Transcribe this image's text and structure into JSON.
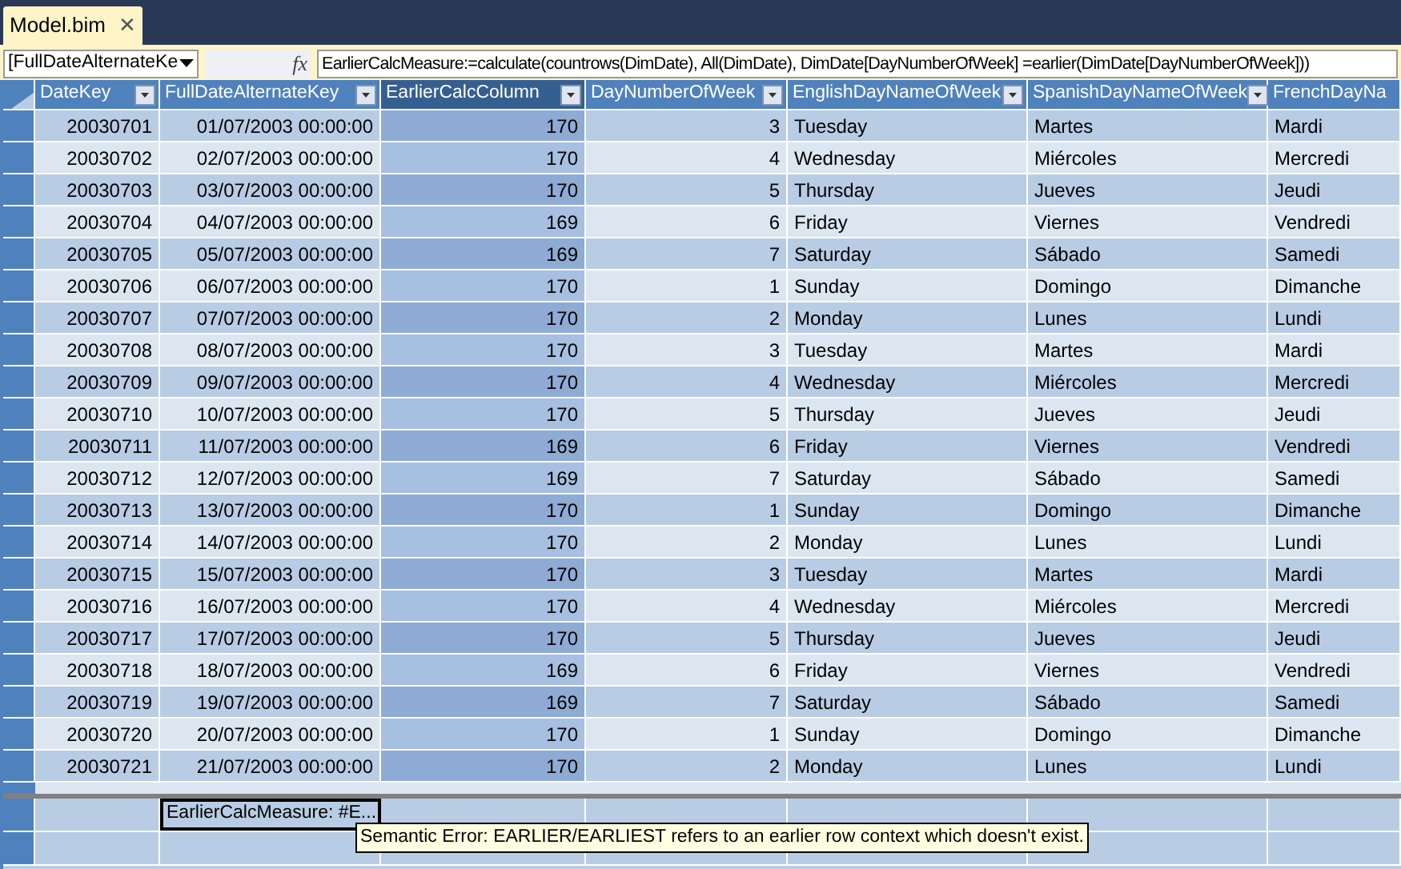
{
  "tab": {
    "title": "Model.bim",
    "close": "✕"
  },
  "formula_bar": {
    "name_box": "[FullDateAlternateKe",
    "function_button": "fx",
    "formula": "EarlierCalcMeasure:=calculate(countrows(DimDate), All(DimDate), DimDate[DayNumberOfWeek] =earlier(DimDate[DayNumberOfWeek]))"
  },
  "table": {
    "columns": [
      {
        "name": "DateKey",
        "selected": false
      },
      {
        "name": "FullDateAlternateKey",
        "selected": false
      },
      {
        "name": "EarlierCalcColumn",
        "selected": true
      },
      {
        "name": "DayNumberOfWeek",
        "selected": false
      },
      {
        "name": "EnglishDayNameOfWeek",
        "selected": false
      },
      {
        "name": "SpanishDayNameOfWeek",
        "selected": false
      },
      {
        "name": "FrenchDayNa",
        "selected": false
      }
    ],
    "rows": [
      [
        "20030701",
        "01/07/2003 00:00:00",
        "170",
        "3",
        "Tuesday",
        "Martes",
        "Mardi"
      ],
      [
        "20030702",
        "02/07/2003 00:00:00",
        "170",
        "4",
        "Wednesday",
        "Miércoles",
        "Mercredi"
      ],
      [
        "20030703",
        "03/07/2003 00:00:00",
        "170",
        "5",
        "Thursday",
        "Jueves",
        "Jeudi"
      ],
      [
        "20030704",
        "04/07/2003 00:00:00",
        "169",
        "6",
        "Friday",
        "Viernes",
        "Vendredi"
      ],
      [
        "20030705",
        "05/07/2003 00:00:00",
        "169",
        "7",
        "Saturday",
        "Sábado",
        "Samedi"
      ],
      [
        "20030706",
        "06/07/2003 00:00:00",
        "170",
        "1",
        "Sunday",
        "Domingo",
        "Dimanche"
      ],
      [
        "20030707",
        "07/07/2003 00:00:00",
        "170",
        "2",
        "Monday",
        "Lunes",
        "Lundi"
      ],
      [
        "20030708",
        "08/07/2003 00:00:00",
        "170",
        "3",
        "Tuesday",
        "Martes",
        "Mardi"
      ],
      [
        "20030709",
        "09/07/2003 00:00:00",
        "170",
        "4",
        "Wednesday",
        "Miércoles",
        "Mercredi"
      ],
      [
        "20030710",
        "10/07/2003 00:00:00",
        "170",
        "5",
        "Thursday",
        "Jueves",
        "Jeudi"
      ],
      [
        "20030711",
        "11/07/2003 00:00:00",
        "169",
        "6",
        "Friday",
        "Viernes",
        "Vendredi"
      ],
      [
        "20030712",
        "12/07/2003 00:00:00",
        "169",
        "7",
        "Saturday",
        "Sábado",
        "Samedi"
      ],
      [
        "20030713",
        "13/07/2003 00:00:00",
        "170",
        "1",
        "Sunday",
        "Domingo",
        "Dimanche"
      ],
      [
        "20030714",
        "14/07/2003 00:00:00",
        "170",
        "2",
        "Monday",
        "Lunes",
        "Lundi"
      ],
      [
        "20030715",
        "15/07/2003 00:00:00",
        "170",
        "3",
        "Tuesday",
        "Martes",
        "Mardi"
      ],
      [
        "20030716",
        "16/07/2003 00:00:00",
        "170",
        "4",
        "Wednesday",
        "Miércoles",
        "Mercredi"
      ],
      [
        "20030717",
        "17/07/2003 00:00:00",
        "170",
        "5",
        "Thursday",
        "Jueves",
        "Jeudi"
      ],
      [
        "20030718",
        "18/07/2003 00:00:00",
        "169",
        "6",
        "Friday",
        "Viernes",
        "Vendredi"
      ],
      [
        "20030719",
        "19/07/2003 00:00:00",
        "169",
        "7",
        "Saturday",
        "Sábado",
        "Samedi"
      ],
      [
        "20030720",
        "20/07/2003 00:00:00",
        "170",
        "1",
        "Sunday",
        "Domingo",
        "Dimanche"
      ],
      [
        "20030721",
        "21/07/2003 00:00:00",
        "170",
        "2",
        "Monday",
        "Lunes",
        "Lundi"
      ]
    ]
  },
  "measure_grid": {
    "measure": "EarlierCalcMeasure: #E...",
    "error_tooltip": "Semantic Error: EARLIER/EARLIEST refers to an earlier row context which doesn't exist."
  }
}
